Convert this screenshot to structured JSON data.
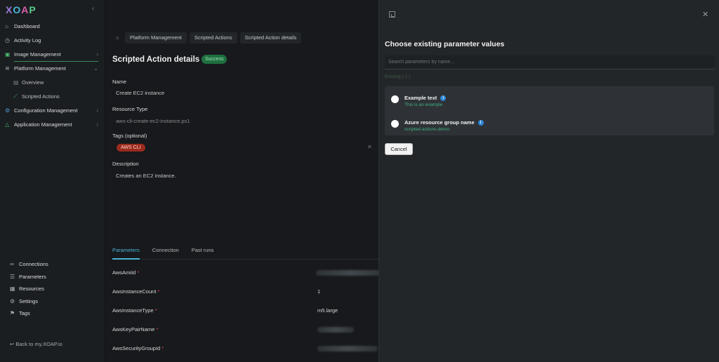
{
  "app": {
    "logo": [
      "X",
      "O",
      "A",
      "P"
    ]
  },
  "sidebar": {
    "items": [
      {
        "label": "Dashboard",
        "icon": "home-icon"
      },
      {
        "label": "Activity Log",
        "icon": "clock-icon"
      },
      {
        "label": "Image Management",
        "icon": "image-icon"
      },
      {
        "label": "Platform Management",
        "icon": "layers-icon"
      },
      {
        "label": "Overview",
        "icon": "grid-icon"
      },
      {
        "label": "Scripted Actions",
        "icon": "script-icon"
      },
      {
        "label": "Configuration Management",
        "icon": "config-icon"
      },
      {
        "label": "Application Management",
        "icon": "triangle-icon"
      }
    ],
    "bottom_items": [
      {
        "label": "Connections",
        "icon": "link-icon"
      },
      {
        "label": "Parameters",
        "icon": "list-icon"
      },
      {
        "label": "Resources",
        "icon": "stack-icon"
      },
      {
        "label": "Settings",
        "icon": "gear-icon"
      },
      {
        "label": "Tags",
        "icon": "bookmark-icon"
      }
    ],
    "back_link": "Back to my.XOAP.io"
  },
  "breadcrumb": [
    "Platform Management",
    "Scripted Actions",
    "Scripted Action details"
  ],
  "page": {
    "title": "Scripted Action details",
    "status": "Success",
    "name_label": "Name",
    "name_value": "Create EC2 instance",
    "resource_label": "Resource Type",
    "resource_value": "aws-cli-create-ec2-instance.ps1",
    "tags_label": "Tags (optional)",
    "tag": "AWS CLI",
    "description_label": "Description",
    "description_value": "Creates an EC2 instance."
  },
  "tabs": [
    "Parameters",
    "Connection",
    "Past runs"
  ],
  "parameters": [
    {
      "name": "AwsAmiId",
      "value": ""
    },
    {
      "name": "AwsInstanceCount",
      "value": "1"
    },
    {
      "name": "AwsInstanceType",
      "value": "m5.large"
    },
    {
      "name": "AwsKeyPairName",
      "value": ""
    },
    {
      "name": "AwsSecurityGroupId",
      "value": ""
    }
  ],
  "panel": {
    "title": "Choose existing parameter values",
    "search_placeholder": "Search parameters by name...",
    "found_label": "Existing ( 2 )",
    "options": [
      {
        "name": "Example text",
        "value": "This is an example"
      },
      {
        "name": "Azure resource group name",
        "value": "scripted-actions-demo"
      }
    ],
    "cancel_label": "Cancel"
  },
  "colors": {
    "accent": "#4ab4d8",
    "success": "#1f6f3f",
    "tag": "#9a2b1e",
    "option_value": "#3fb27f"
  }
}
